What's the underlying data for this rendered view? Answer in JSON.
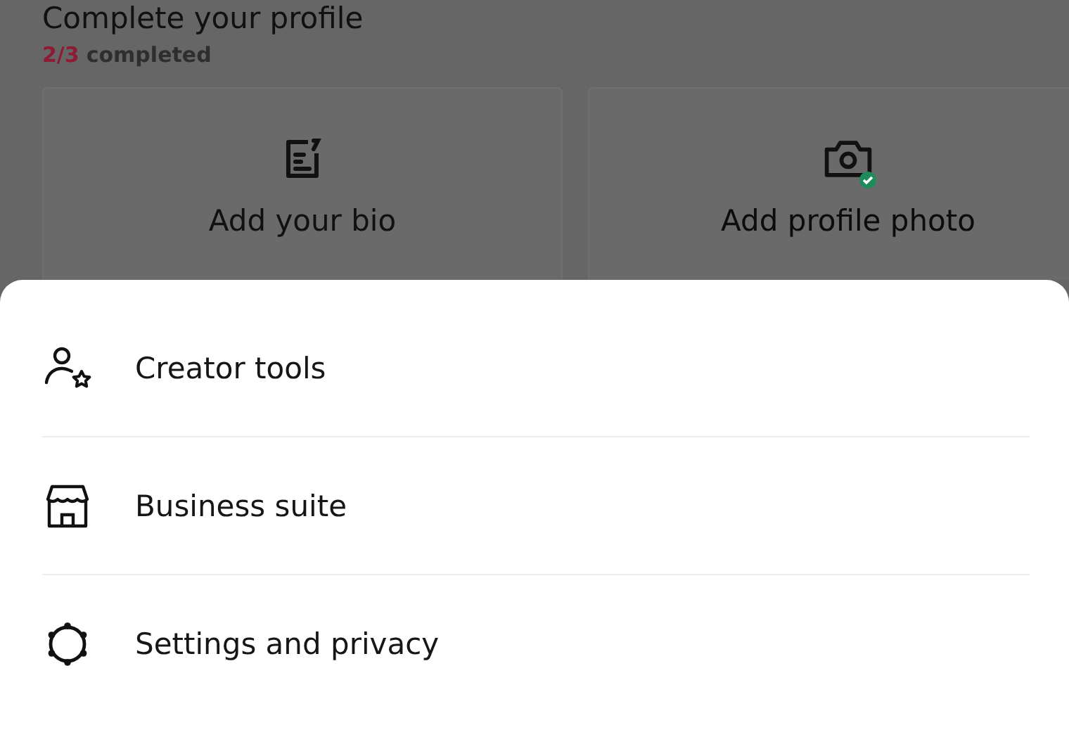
{
  "profile_card": {
    "title": "Complete your profile",
    "progress": "2/3",
    "progress_label": "completed",
    "tasks": [
      {
        "label": "Add your bio",
        "kind": "bio",
        "completed": false
      },
      {
        "label": "Add profile photo",
        "kind": "photo",
        "completed": true
      }
    ]
  },
  "menu": {
    "items": [
      {
        "label": "Creator tools",
        "kind": "creator"
      },
      {
        "label": "Business suite",
        "kind": "business"
      },
      {
        "label": "Settings and privacy",
        "kind": "settings"
      }
    ]
  }
}
